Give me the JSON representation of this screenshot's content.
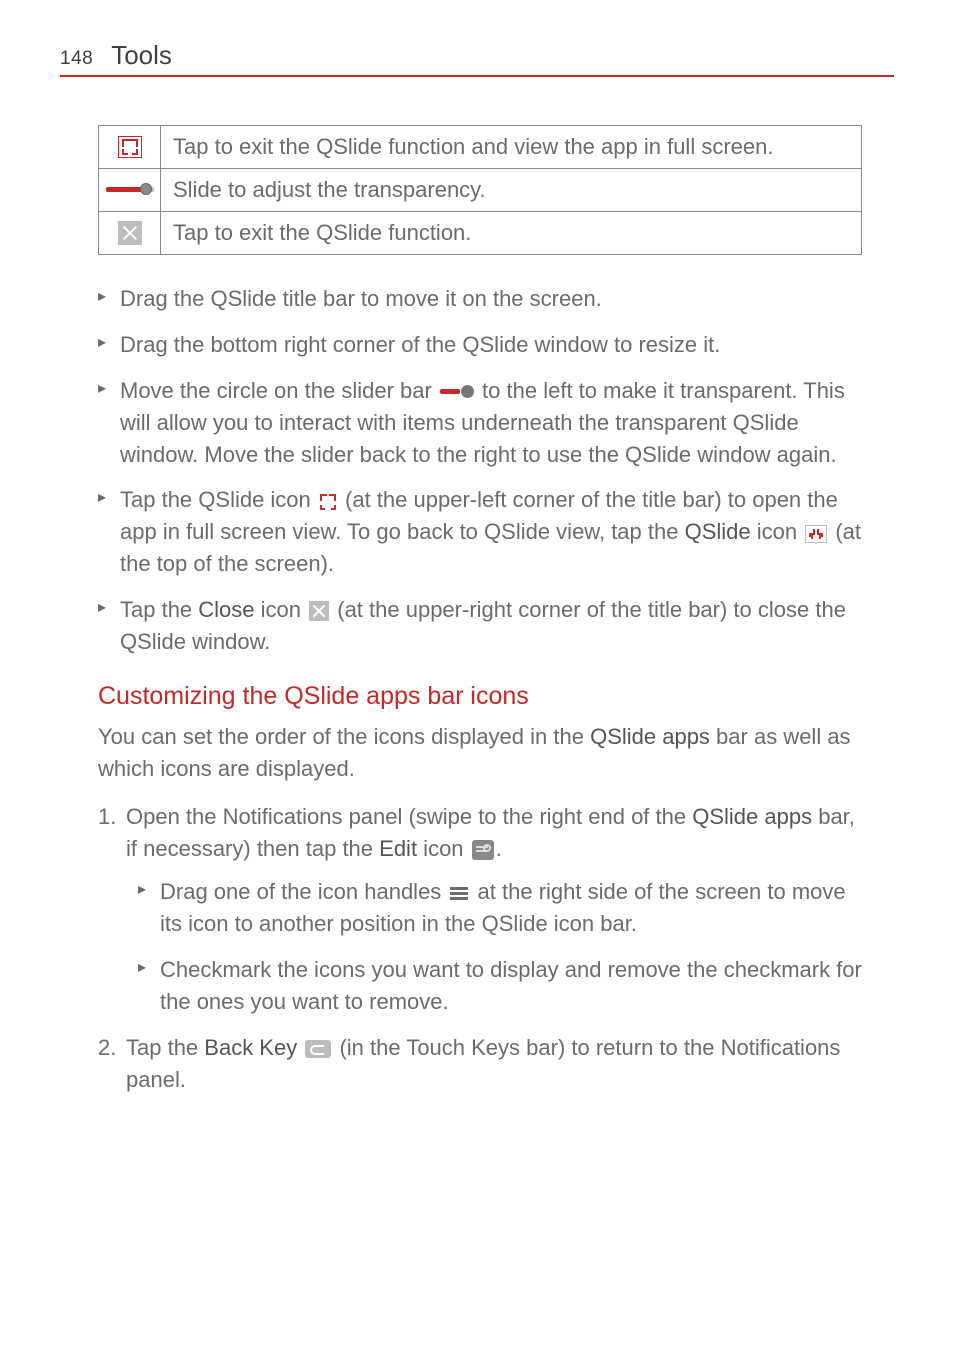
{
  "header": {
    "page_number": "148",
    "title": "Tools"
  },
  "table": {
    "rows": [
      {
        "desc": "Tap to exit the QSlide function and view the app in full screen."
      },
      {
        "desc": "Slide to adjust the transparency."
      },
      {
        "desc": "Tap to exit the QSlide function."
      }
    ]
  },
  "bullets_top": {
    "b1": "Drag the QSlide title bar to move it on the screen.",
    "b2": "Drag the bottom right corner of the QSlide window to resize it.",
    "b3a": "Move the circle on the slider bar ",
    "b3b": " to the left to make it transparent. This will allow you to interact with items underneath the transparent QSlide window. Move the slider back to the right to use the QSlide window again.",
    "b4a": "Tap the QSlide icon ",
    "b4b": " (at the upper-left corner of the title bar) to open the app in full screen view. To go back to QSlide view, tap the ",
    "b4_bold": "QSlide",
    "b4c": " icon ",
    "b4d": " (at the top of the screen).",
    "b5a": "Tap the ",
    "b5_bold": "Close",
    "b5b": " icon ",
    "b5c": " (at the upper-right corner of the title bar) to close the QSlide window."
  },
  "section": {
    "heading": "Customizing the QSlide apps bar icons",
    "intro_a": "You can set the order of the icons displayed in the ",
    "intro_bold": "QSlide apps",
    "intro_b": " bar as well as which icons are displayed."
  },
  "steps": {
    "s1a": "Open the Notifications panel (swipe to the right end of the ",
    "s1_bold1": "QSlide apps",
    "s1b": " bar, if necessary) then tap the ",
    "s1_bold2": "Edit",
    "s1c": " icon ",
    "s1d": ".",
    "s1_sub1a": "Drag one of the icon handles ",
    "s1_sub1b": " at the right side of the screen to move its icon to another position in the QSlide icon bar.",
    "s1_sub2": "Checkmark the icons you want to display and remove the checkmark for the ones you want to remove.",
    "s2a": "Tap the ",
    "s2_bold": "Back Key",
    "s2b": " ",
    "s2c": " (in the Touch Keys bar) to return to the Notifications panel."
  }
}
